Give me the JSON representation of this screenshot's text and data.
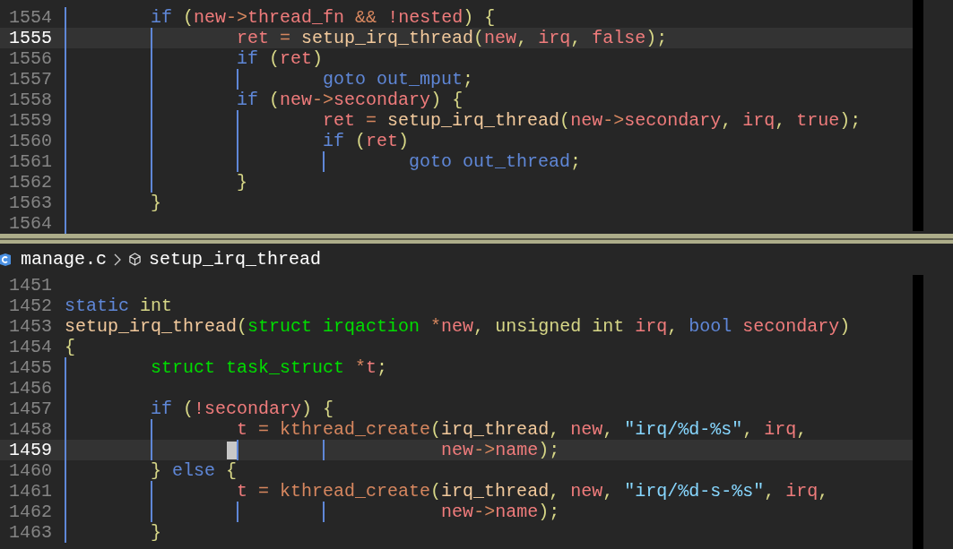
{
  "top_pane": {
    "lines": [
      {
        "number": "1554",
        "current": false,
        "cursor": false,
        "tokens": [
          {
            "text": "\tif",
            "kind": "keyword"
          },
          {
            "text": " (",
            "kind": "punct"
          },
          {
            "text": "new",
            "kind": "variable"
          },
          {
            "text": "->",
            "kind": "operator"
          },
          {
            "text": "thread_fn",
            "kind": "variable"
          },
          {
            "text": " && ",
            "kind": "operator"
          },
          {
            "text": "!nested",
            "kind": "variable"
          },
          {
            "text": ") {",
            "kind": "punct"
          }
        ]
      },
      {
        "number": "1555",
        "current": true,
        "cursor": false,
        "tokens": [
          {
            "text": "\t\tret",
            "kind": "variable"
          },
          {
            "text": " = ",
            "kind": "operator"
          },
          {
            "text": "setup_irq_thread",
            "kind": "function"
          },
          {
            "text": "(",
            "kind": "punct"
          },
          {
            "text": "new",
            "kind": "variable"
          },
          {
            "text": ", ",
            "kind": "punct"
          },
          {
            "text": "irq",
            "kind": "variable"
          },
          {
            "text": ", ",
            "kind": "punct"
          },
          {
            "text": "false",
            "kind": "variable"
          },
          {
            "text": ");",
            "kind": "punct"
          }
        ]
      },
      {
        "number": "1556",
        "current": false,
        "cursor": false,
        "tokens": [
          {
            "text": "\t\tif",
            "kind": "keyword"
          },
          {
            "text": " (",
            "kind": "punct"
          },
          {
            "text": "ret",
            "kind": "variable"
          },
          {
            "text": ")",
            "kind": "punct"
          }
        ]
      },
      {
        "number": "1557",
        "current": false,
        "cursor": false,
        "tokens": [
          {
            "text": "\t\t\tgoto out_mput",
            "kind": "keyword"
          },
          {
            "text": ";",
            "kind": "punct"
          }
        ]
      },
      {
        "number": "1558",
        "current": false,
        "cursor": false,
        "tokens": [
          {
            "text": "\t\tif",
            "kind": "keyword"
          },
          {
            "text": " (",
            "kind": "punct"
          },
          {
            "text": "new",
            "kind": "variable"
          },
          {
            "text": "->",
            "kind": "operator"
          },
          {
            "text": "secondary",
            "kind": "variable"
          },
          {
            "text": ") {",
            "kind": "punct"
          }
        ]
      },
      {
        "number": "1559",
        "current": false,
        "cursor": false,
        "tokens": [
          {
            "text": "\t\t\tret",
            "kind": "variable"
          },
          {
            "text": " = ",
            "kind": "operator"
          },
          {
            "text": "setup_irq_thread",
            "kind": "function"
          },
          {
            "text": "(",
            "kind": "punct"
          },
          {
            "text": "new",
            "kind": "variable"
          },
          {
            "text": "->",
            "kind": "operator"
          },
          {
            "text": "secondary",
            "kind": "variable"
          },
          {
            "text": ", ",
            "kind": "punct"
          },
          {
            "text": "irq",
            "kind": "variable"
          },
          {
            "text": ", ",
            "kind": "punct"
          },
          {
            "text": "true",
            "kind": "variable"
          },
          {
            "text": ");",
            "kind": "punct"
          }
        ]
      },
      {
        "number": "1560",
        "current": false,
        "cursor": false,
        "tokens": [
          {
            "text": "\t\t\tif",
            "kind": "keyword"
          },
          {
            "text": " (",
            "kind": "punct"
          },
          {
            "text": "ret",
            "kind": "variable"
          },
          {
            "text": ")",
            "kind": "punct"
          }
        ]
      },
      {
        "number": "1561",
        "current": false,
        "cursor": false,
        "tokens": [
          {
            "text": "\t\t\t\tgoto out_thread",
            "kind": "keyword"
          },
          {
            "text": ";",
            "kind": "punct"
          }
        ]
      },
      {
        "number": "1562",
        "current": false,
        "cursor": false,
        "tokens": [
          {
            "text": "\t\t}",
            "kind": "punct"
          }
        ]
      },
      {
        "number": "1563",
        "current": false,
        "cursor": false,
        "tokens": [
          {
            "text": "\t}",
            "kind": "punct"
          }
        ]
      },
      {
        "number": "1564",
        "current": false,
        "cursor": false
      }
    ]
  },
  "breadcrumb": {
    "file": "manage.c",
    "symbol": "setup_irq_thread"
  },
  "bottom_pane": {
    "lines": [
      {
        "number": "1451",
        "current": false,
        "cursor": false
      },
      {
        "number": "1452",
        "current": false,
        "cursor": false,
        "tokens": [
          {
            "text": "static",
            "kind": "keyword"
          },
          {
            "text": " int",
            "kind": "primitive"
          }
        ]
      },
      {
        "number": "1453",
        "current": false,
        "cursor": false,
        "tokens": [
          {
            "text": "setup_irq_thread",
            "kind": "function"
          },
          {
            "text": "(",
            "kind": "punct"
          },
          {
            "text": "struct irqaction",
            "kind": "type"
          },
          {
            "text": " *",
            "kind": "operator"
          },
          {
            "text": "new",
            "kind": "variable"
          },
          {
            "text": ", ",
            "kind": "punct"
          },
          {
            "text": "unsigned int",
            "kind": "primitive"
          },
          {
            "text": " irq",
            "kind": "variable"
          },
          {
            "text": ", ",
            "kind": "punct"
          },
          {
            "text": "bool",
            "kind": "keyword"
          },
          {
            "text": " secondary",
            "kind": "variable"
          },
          {
            "text": ")",
            "kind": "punct"
          }
        ]
      },
      {
        "number": "1454",
        "current": false,
        "cursor": false,
        "tokens": [
          {
            "text": "{",
            "kind": "punct"
          }
        ]
      },
      {
        "number": "1455",
        "current": false,
        "cursor": false,
        "tokens": [
          {
            "text": "\tstruct task_struct",
            "kind": "type"
          },
          {
            "text": " *",
            "kind": "operator"
          },
          {
            "text": "t",
            "kind": "variable"
          },
          {
            "text": ";",
            "kind": "punct"
          }
        ]
      },
      {
        "number": "1456",
        "current": false,
        "cursor": false
      },
      {
        "number": "1457",
        "current": false,
        "cursor": false,
        "tokens": [
          {
            "text": "\tif",
            "kind": "keyword"
          },
          {
            "text": " (",
            "kind": "punct"
          },
          {
            "text": "!secondary",
            "kind": "variable"
          },
          {
            "text": ") {",
            "kind": "punct"
          }
        ]
      },
      {
        "number": "1458",
        "current": false,
        "cursor": false,
        "tokens": [
          {
            "text": "\t\tt",
            "kind": "variable"
          },
          {
            "text": " = ",
            "kind": "operator"
          },
          {
            "text": "kthread_create",
            "kind": "macro"
          },
          {
            "text": "(",
            "kind": "punct"
          },
          {
            "text": "irq_thread",
            "kind": "function"
          },
          {
            "text": ", ",
            "kind": "punct"
          },
          {
            "text": "new",
            "kind": "variable"
          },
          {
            "text": ", ",
            "kind": "punct"
          },
          {
            "text": "\"irq/%d-%s\"",
            "kind": "string"
          },
          {
            "text": ", ",
            "kind": "punct"
          },
          {
            "text": "irq",
            "kind": "variable"
          },
          {
            "text": ",",
            "kind": "punct"
          }
        ]
      },
      {
        "number": "1459",
        "current": true,
        "cursor": true,
        "tokens": [
          {
            "text": "\t\t\t\t   new",
            "kind": "variable"
          },
          {
            "text": "->",
            "kind": "operator"
          },
          {
            "text": "name",
            "kind": "variable"
          },
          {
            "text": ");",
            "kind": "punct"
          }
        ]
      },
      {
        "number": "1460",
        "current": false,
        "cursor": false,
        "tokens": [
          {
            "text": "\t}",
            "kind": "punct"
          },
          {
            "text": " else",
            "kind": "keyword"
          },
          {
            "text": " {",
            "kind": "punct"
          }
        ]
      },
      {
        "number": "1461",
        "current": false,
        "cursor": false,
        "tokens": [
          {
            "text": "\t\tt",
            "kind": "variable"
          },
          {
            "text": " = ",
            "kind": "operator"
          },
          {
            "text": "kthread_create",
            "kind": "macro"
          },
          {
            "text": "(",
            "kind": "punct"
          },
          {
            "text": "irq_thread",
            "kind": "function"
          },
          {
            "text": ", ",
            "kind": "punct"
          },
          {
            "text": "new",
            "kind": "variable"
          },
          {
            "text": ", ",
            "kind": "punct"
          },
          {
            "text": "\"irq/%d-s-%s\"",
            "kind": "string"
          },
          {
            "text": ", ",
            "kind": "punct"
          },
          {
            "text": "irq",
            "kind": "variable"
          },
          {
            "text": ",",
            "kind": "punct"
          }
        ]
      },
      {
        "number": "1462",
        "current": false,
        "cursor": false,
        "tokens": [
          {
            "text": "\t\t\t\t   new",
            "kind": "variable"
          },
          {
            "text": "->",
            "kind": "operator"
          },
          {
            "text": "name",
            "kind": "variable"
          },
          {
            "text": ");",
            "kind": "punct"
          }
        ]
      },
      {
        "number": "1463",
        "current": false,
        "cursor": false,
        "tokens": [
          {
            "text": "\t}",
            "kind": "punct"
          }
        ]
      }
    ]
  }
}
